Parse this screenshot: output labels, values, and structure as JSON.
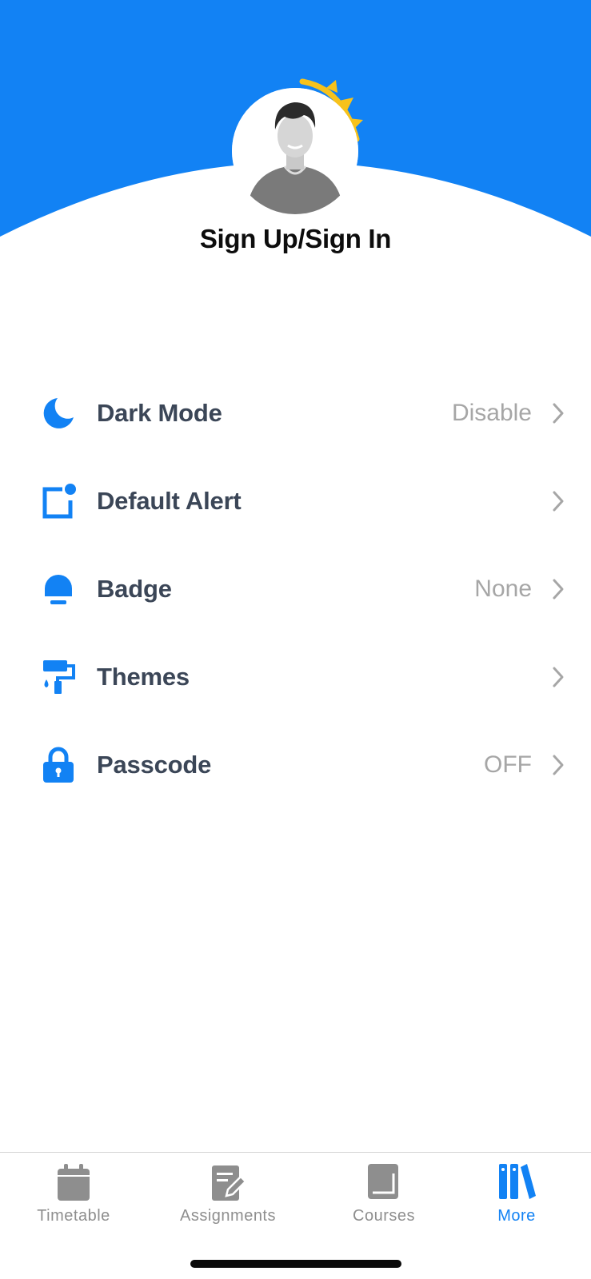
{
  "header": {
    "signin_label": "Sign Up/Sign In",
    "accent_color": "#1282f4",
    "sun_color": "#f7c21c"
  },
  "settings": {
    "items": [
      {
        "label": "Dark Mode",
        "value": "Disable",
        "icon": "moon-icon"
      },
      {
        "label": "Default Alert",
        "value": "",
        "icon": "alert-square-icon"
      },
      {
        "label": "Badge",
        "value": "None",
        "icon": "bell-icon"
      },
      {
        "label": "Themes",
        "value": "",
        "icon": "paint-roller-icon"
      },
      {
        "label": "Passcode",
        "value": "OFF",
        "icon": "lock-icon"
      }
    ]
  },
  "tabbar": {
    "tabs": [
      {
        "label": "Timetable",
        "icon": "calendar-icon",
        "active": false
      },
      {
        "label": "Assignments",
        "icon": "edit-note-icon",
        "active": false
      },
      {
        "label": "Courses",
        "icon": "book-icon",
        "active": false
      },
      {
        "label": "More",
        "icon": "library-icon",
        "active": true
      }
    ],
    "inactive_color": "#8e8e8e",
    "active_color": "#1282f4"
  }
}
